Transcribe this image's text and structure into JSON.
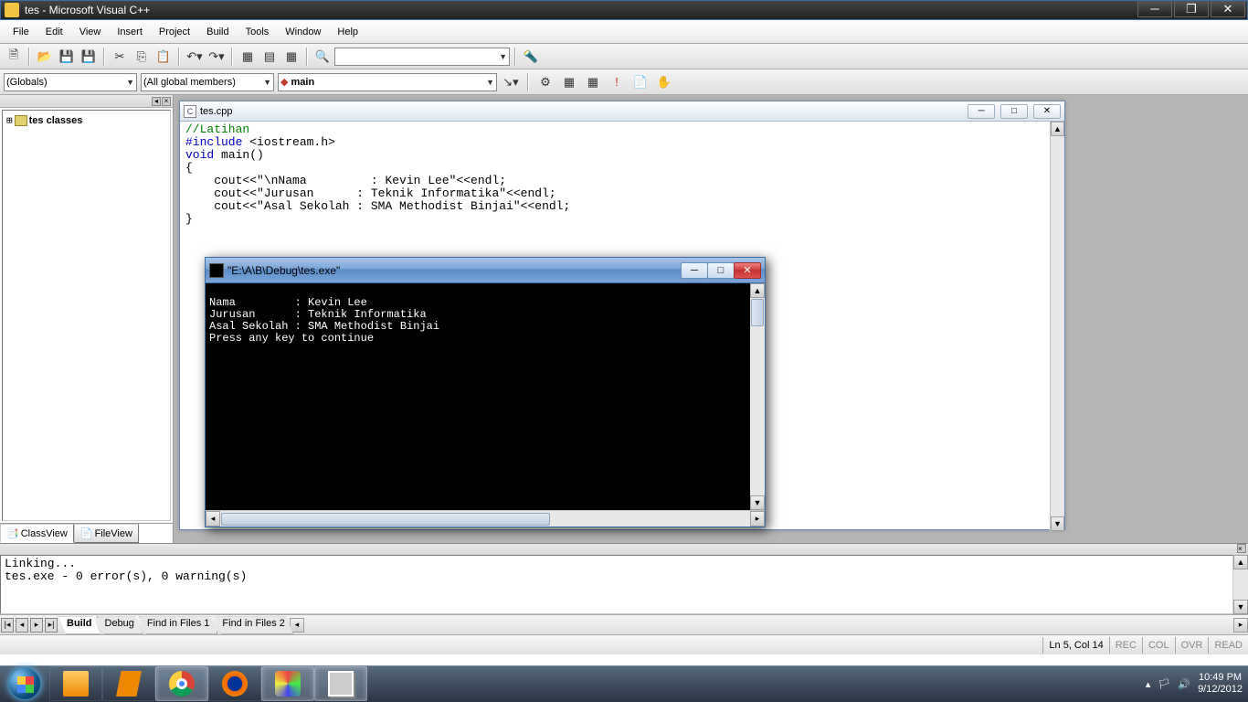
{
  "window": {
    "title": "tes - Microsoft Visual C++"
  },
  "menu": {
    "items": [
      "File",
      "Edit",
      "View",
      "Insert",
      "Project",
      "Build",
      "Tools",
      "Window",
      "Help"
    ]
  },
  "toolbar2": {
    "scope_combo": "(Globals)",
    "members_combo": "(All global members)",
    "symbol_combo": "main"
  },
  "sidebar": {
    "root": "tes classes",
    "tabs": [
      "ClassView",
      "FileView"
    ]
  },
  "editor": {
    "filename": "tes.cpp",
    "code_comment": "//Latihan",
    "code_include_kw": "#include",
    "code_include_rest": " <iostream.h>",
    "code_voidmain": "void",
    "code_voidmain_rest": " main()",
    "line_open": "{",
    "line1a": "    cout<<",
    "line1b": "\"\\nNama         : Kevin Lee\"",
    "line1c": "<<endl;",
    "line2a": "    cout<<",
    "line2b": "\"Jurusan      : Teknik Informatika\"",
    "line2c": "<<endl;",
    "line3a": "    cout<<",
    "line3b": "\"Asal Sekolah : SMA Methodist Binjai\"",
    "line3c": "<<endl;",
    "line_close": "}"
  },
  "console": {
    "title": "\"E:\\A\\B\\Debug\\tes.exe\"",
    "output": "\nNama         : Kevin Lee\nJurusan      : Teknik Informatika\nAsal Sekolah : SMA Methodist Binjai\nPress any key to continue"
  },
  "output": {
    "text": "Linking...\ntes.exe - 0 error(s), 0 warning(s)\n",
    "tabs": [
      "Build",
      "Debug",
      "Find in Files 1",
      "Find in Files 2"
    ]
  },
  "status": {
    "pos": "Ln 5, Col 14",
    "rec": "REC",
    "col": "COL",
    "ovr": "OVR",
    "read": "READ"
  },
  "tray": {
    "time": "10:49 PM",
    "date": "9/12/2012"
  }
}
